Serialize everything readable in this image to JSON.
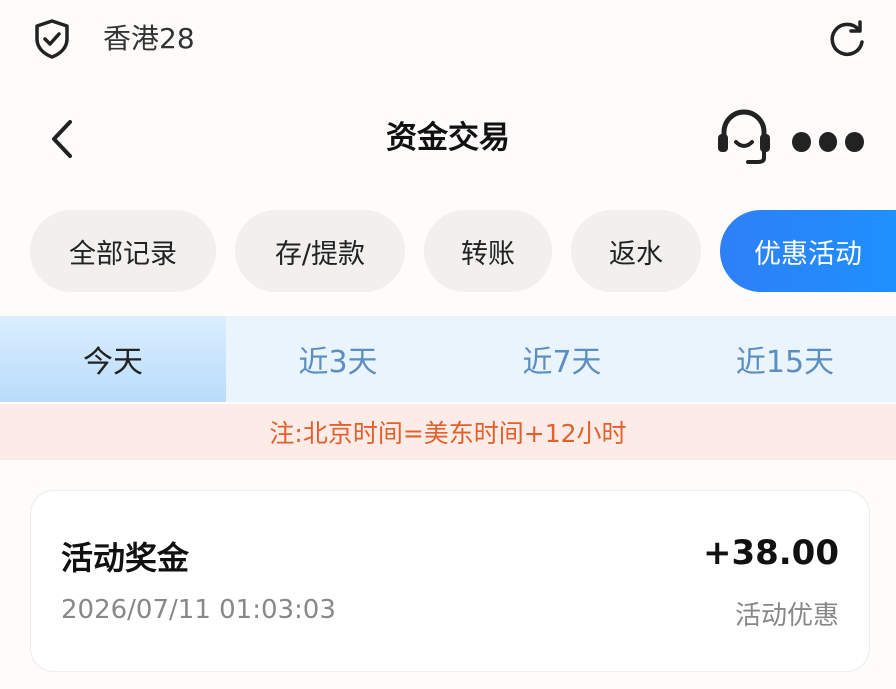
{
  "status_bar": {
    "app_title": "香港28"
  },
  "header": {
    "title": "资金交易"
  },
  "filters": [
    {
      "label": "全部记录",
      "active": false
    },
    {
      "label": "存/提款",
      "active": false
    },
    {
      "label": "转账",
      "active": false
    },
    {
      "label": "返水",
      "active": false
    },
    {
      "label": "优惠活动",
      "active": true
    }
  ],
  "day_tabs": [
    {
      "label": "今天",
      "active": true
    },
    {
      "label": "近3天",
      "active": false
    },
    {
      "label": "近7天",
      "active": false
    },
    {
      "label": "近15天",
      "active": false
    }
  ],
  "notice": "注:北京时间=美东时间+12小时",
  "records": [
    {
      "title": "活动奖金",
      "amount": "+38.00",
      "time": "2026/07/11 01:03:03",
      "type": "活动优惠"
    }
  ],
  "colors": {
    "accent": "#1e88ff",
    "notice_text": "#e35f2c",
    "notice_bg": "#fcebe6",
    "tab_bg": "#eaf4fd"
  },
  "icons": [
    "shield-icon",
    "refresh-icon",
    "back-arrow-icon",
    "headset-icon",
    "more-icon"
  ]
}
